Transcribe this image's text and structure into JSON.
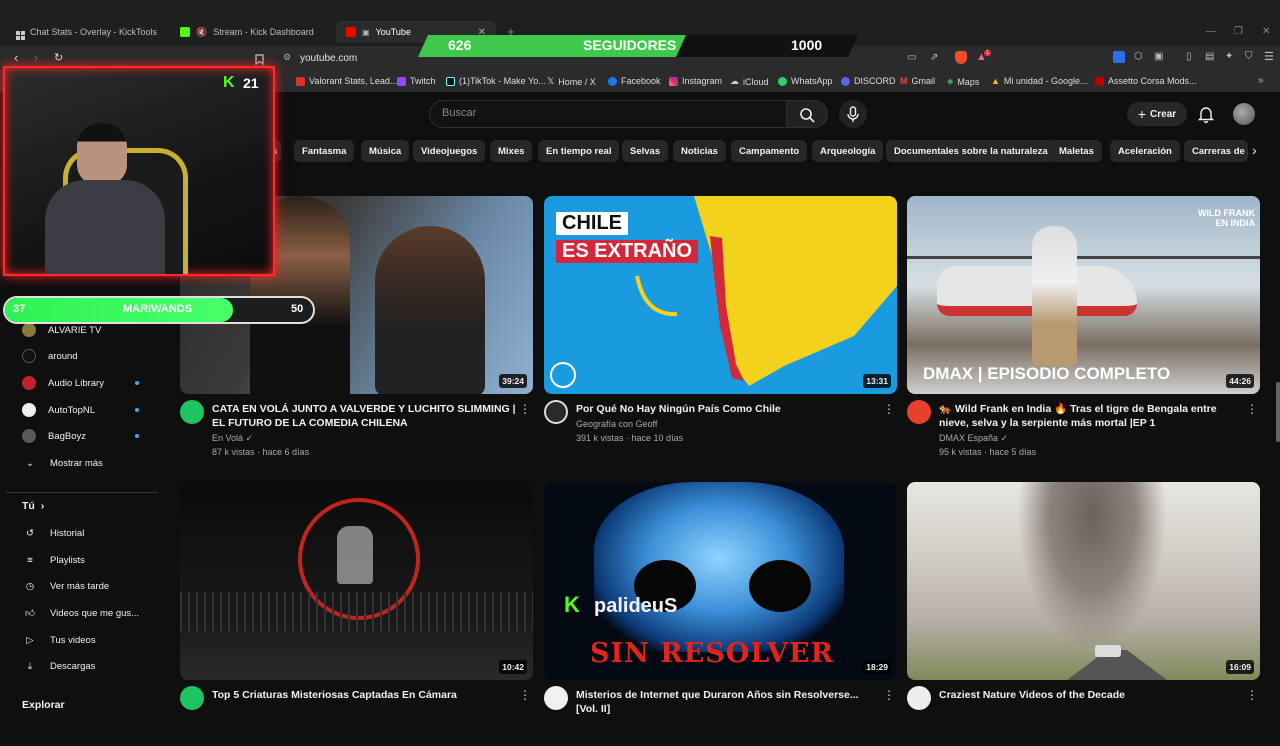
{
  "browser": {
    "tabs": [
      {
        "title": "Chat Stats - Overlay - KickTools"
      },
      {
        "title": "Stream - Kick Dashboard"
      },
      {
        "title": "YouTube"
      }
    ],
    "url": "youtube.com",
    "bookmarks": [
      "Valorant Stats, Lead...",
      "Twitch",
      "(1)TikTok - Make Yo...",
      "Home / X",
      "Facebook",
      "Instagram",
      "iCloud",
      "WhatsApp",
      "DISCORD",
      "Gmail",
      "Maps",
      "Mi unidad - Google...",
      "Assetto Corsa Mods..."
    ],
    "extension_badge": "1"
  },
  "overlay": {
    "followers_current": "626",
    "followers_label": "SEGUIDORES",
    "followers_goal": "1000",
    "kick_viewers": "21",
    "goal_current": "37",
    "goal_label": "MARIWANDS",
    "goal_target": "50",
    "goal_fraction": 0.74
  },
  "youtube": {
    "search_placeholder": "Buscar",
    "create_label": "Crear",
    "chips": [
      "s",
      "Fantasma",
      "Música",
      "Videojuegos",
      "Mixes",
      "En tiempo real",
      "Selvas",
      "Noticias",
      "Campamento",
      "Arqueología",
      "Documentales sobre la naturaleza",
      "Maletas",
      "Aceleración",
      "Carreras de a"
    ],
    "subscriptions": [
      {
        "name": "ALVARIE TV",
        "live": false
      },
      {
        "name": "around",
        "live": false
      },
      {
        "name": "Audio Library",
        "live": true
      },
      {
        "name": "AutoTopNL",
        "live": true
      },
      {
        "name": "BagBoyz",
        "live": true
      }
    ],
    "show_more": "Mostrar más",
    "you_section": "Tú",
    "you_items": [
      "Historial",
      "Playlists",
      "Ver más tarde",
      "Videos que me gus...",
      "Tus videos",
      "Descargas"
    ],
    "explore_partial": "Explorar",
    "videos": [
      {
        "title": "CATA EN VOLÁ JUNTO A VALVERDE Y LUCHITO SLIMMING | EL FUTURO DE LA COMEDIA CHILENA",
        "channel": "En Volá",
        "views": "87 k vistas",
        "age": "hace 6 días",
        "duration": "39:24"
      },
      {
        "title": "Por Qué No Hay Ningún País Como Chile",
        "channel": "Geografía con Geoff",
        "views": "391 k vistas",
        "age": "hace 10 días",
        "duration": "13:31",
        "thumb_text1": "CHILE",
        "thumb_text2": "ES EXTRAÑO"
      },
      {
        "title": "🐅 Wild Frank en India 🔥 Tras el tigre de Bengala entre nieve, selva y la serpiente más mortal |EP 1",
        "channel": "DMAX España",
        "views": "95 k vistas",
        "age": "hace 5 días",
        "duration": "44:26",
        "thumb_text1": "WILD FRANK EN INDIA",
        "thumb_text2": "DMAX | EPISODIO COMPLETO"
      },
      {
        "title": "Top 5 Criaturas Misteriosas Captadas En Cámara",
        "duration": "10:42"
      },
      {
        "title": "Misterios de Internet que Duraron Años sin Resolverse... [Vol. II]",
        "duration": "18:29",
        "thumb_text1": "palideuS",
        "thumb_text2": "SIN RESOLVER"
      },
      {
        "title": "Craziest Nature Videos of the Decade",
        "duration": "16:09"
      }
    ]
  }
}
